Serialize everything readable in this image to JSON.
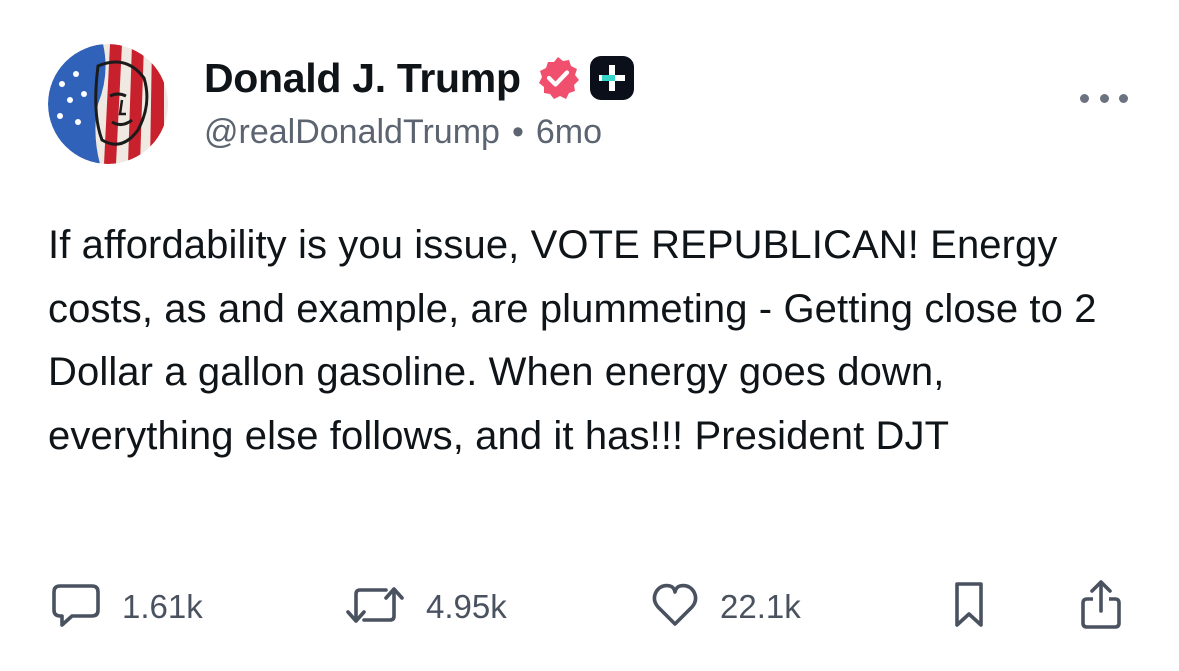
{
  "post": {
    "author_name": "Donald J. Trump",
    "handle": "@realDonaldTrump",
    "separator": "•",
    "timestamp": "6mo",
    "text": "If affordability is you issue, VOTE REPUBLICAN! Energy costs, as and example, are plummeting - Getting close to 2 Dollar a gallon gasoline. When energy goes down, everything else follows, and it has!!! President DJT"
  },
  "actions": {
    "replies": "1.61k",
    "reposts": "4.95k",
    "likes": "22.1k"
  },
  "icons": {
    "verified": "verified-badge-icon",
    "plus": "plus-badge-icon",
    "more": "more-options-icon",
    "reply": "reply-icon",
    "repost": "repost-icon",
    "like": "heart-icon",
    "bookmark": "bookmark-icon",
    "share": "share-icon"
  },
  "colors": {
    "verified": "#f0506e",
    "plus_badge": "#0b0f19",
    "plus_accent": "#35d6c8",
    "text": "#0f1419",
    "secondary": "#5b6470"
  }
}
